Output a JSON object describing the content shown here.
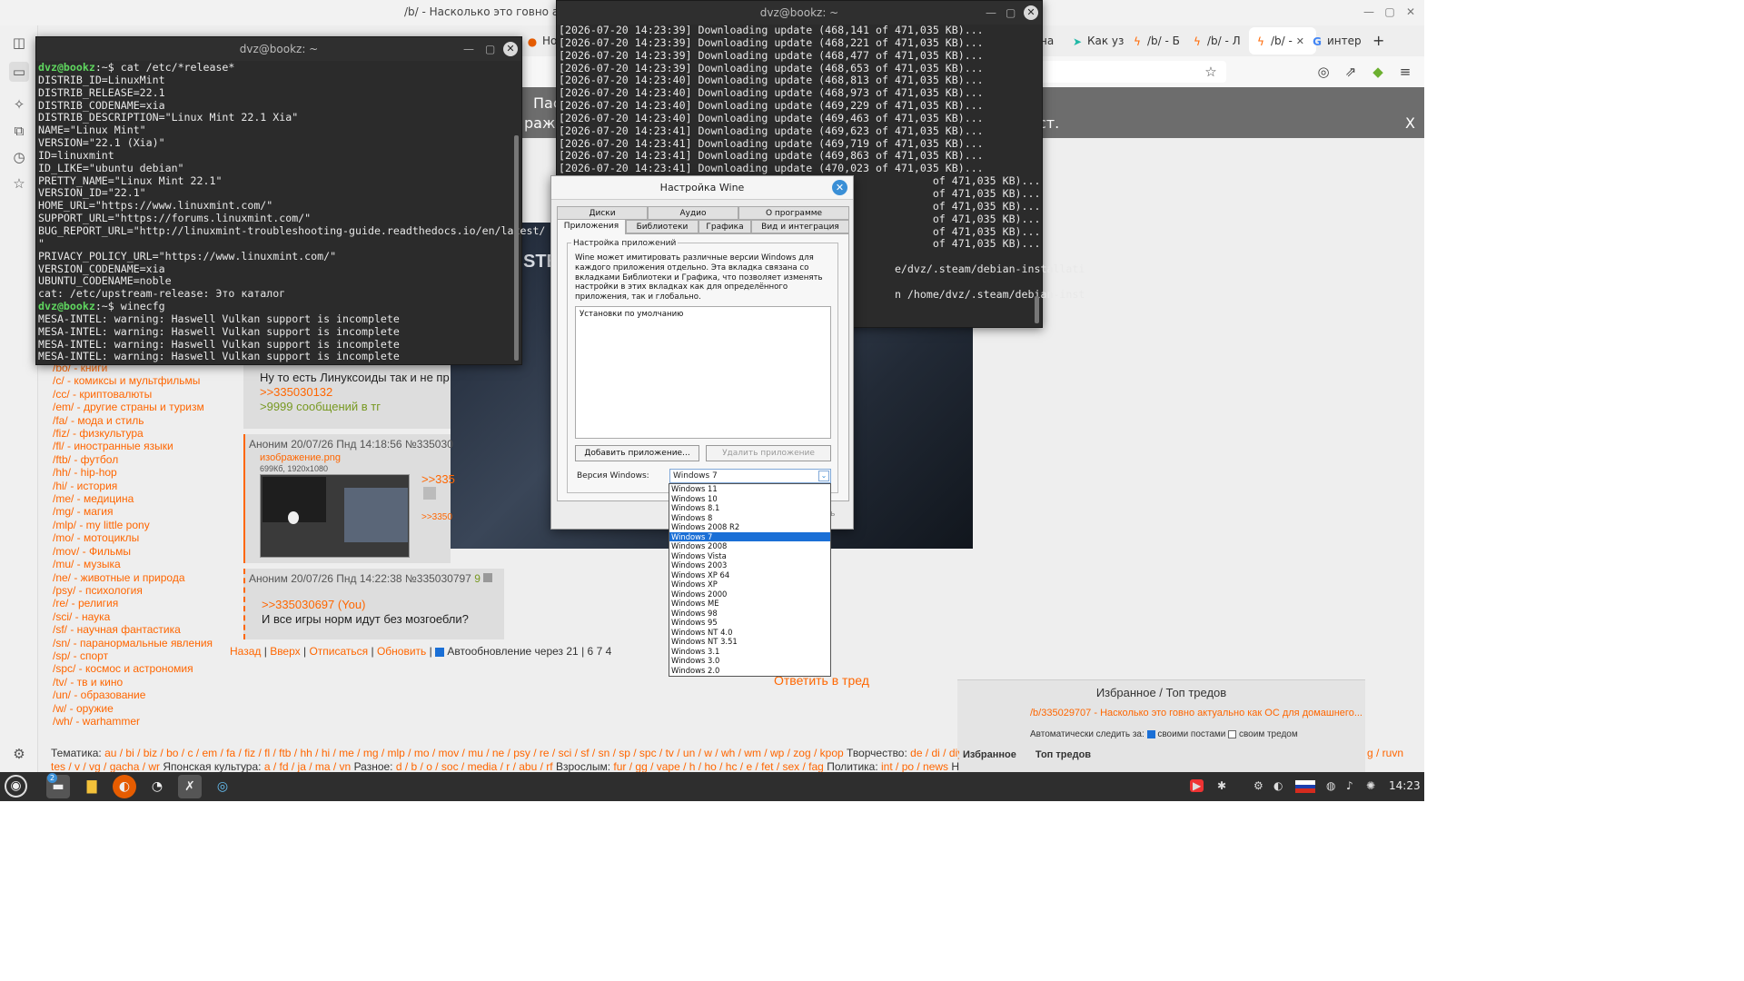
{
  "browser": {
    "window_title": "/b/ - Насколько это говно актуал",
    "tabs": [
      {
        "icon": "●",
        "label": "Нов"
      },
      {
        "icon": "",
        "label": "на"
      },
      {
        "icon": "➤",
        "label": "Как уз"
      },
      {
        "icon": "ϟ",
        "label": "/b/ - Б"
      },
      {
        "icon": "ϟ",
        "label": "/b/ - Л"
      },
      {
        "icon": "ϟ",
        "label": "/b/ -"
      },
      {
        "icon": "G",
        "label": "интер"
      }
    ],
    "tab_close": "✕",
    "new_tab": "+",
    "win_min": "—",
    "win_max": "▢",
    "win_close": "✕",
    "toolbar_icons": {
      "star": "☆",
      "account": "◎",
      "extensions": "⇗",
      "addon": "◆",
      "menu": "≡"
    }
  },
  "sidebar_icons": [
    "▭",
    "◫",
    "✧",
    "⧉",
    "◷",
    "☆",
    "⚙"
  ],
  "banner": {
    "line1": "Пас",
    "line2": "ражен",
    "line3": "ст.",
    "close": "X"
  },
  "dark_image_text": "STE",
  "boards": [
    "/bo/ - книги",
    "/c/ - комиксы и мультфильмы",
    "/cc/ - криптовалюты",
    "/em/ - другие страны и туризм",
    "/fa/ - мода и стиль",
    "/fiz/ - физкультура",
    "/fl/ - иностранные языки",
    "/ftb/ - футбол",
    "/hh/ - hip-hop",
    "/hi/ - история",
    "/me/ - медицина",
    "/mg/ - магия",
    "/mlp/ - my little pony",
    "/mo/ - мотоциклы",
    "/mov/ - Фильмы",
    "/mu/ - музыка",
    "/ne/ - животные и природа",
    "/psy/ - психология",
    "/re/ - религия",
    "/sci/ - наука",
    "/sf/ - научная фантастика",
    "/sn/ - паранормальные явления",
    "/sp/ - спорт",
    "/spc/ - космос и астрономия",
    "/tv/ - тв и кино",
    "/un/ - образование",
    "/w/ - оружие",
    "/wh/ - warhammer"
  ],
  "post1": {
    "text": "Ну то есть Линуксоиды так и не пр",
    "reply_link": ">>335030132",
    "greentext": ">9999 сообщений в тг"
  },
  "post2": {
    "meta": "Аноним   20/07/26 Пнд 14:18:56 №335030",
    "filename": "изображение.png",
    "fileinfo": "699Кб, 1920x1080",
    "reply1": ">>335",
    "reply2": ">>3350"
  },
  "post3": {
    "meta": "Аноним   20/07/26 Пнд 14:22:38 №335030797",
    "num": "9",
    "reply_link": ">>335030697 (You)",
    "text": "И все игры норм идут без мозгоебли?"
  },
  "thread_nav": {
    "back": "Назад",
    "up": "Вверх",
    "unsubscribe": "Отписаться",
    "refresh": "Обновить",
    "autoupdate": "Автообновление через 21",
    "posts": "6",
    "images": "7",
    "users": "4"
  },
  "reply_link": "Ответить в тред",
  "favorites": {
    "header": "Избранное / Топ тредов",
    "item": "/b/335029707 - Насколько это говно актуально как ОС для домашнего...",
    "watch_label": "Автоматически следить за:",
    "opt1": "своими постами",
    "opt2": "своим тредом",
    "tab1": "Избранное",
    "tab2": "Топ тредов"
  },
  "footer": {
    "line1_label": "Тематика:",
    "line1": "au / bi / biz / bo / c / em / fa / fiz / fl / ftb / hh / hi / me / mg / mlp / mo / mov / mu / ne / psy / re / sci / sf / sn / sp / spc / tv / un / w / wh / wm / wp / zog / kpop",
    "line1_b_label": "Творчество:",
    "line1_b": "de / di / diy",
    "line2_a": "tes / v / vg / gacha / wr",
    "line2_b_label": "Японская культура:",
    "line2_b": "a / fd / ja / ma / vn",
    "line2_c_label": "Разное:",
    "line2_c": "d / b / o / soc / media / r / abu / rf",
    "line2_d_label": "Взрослым:",
    "line2_d": "fur / gg / vape / h / ho / hc / e / fet / sex / fag",
    "line2_e_label": "Политика:",
    "line2_e": "int / po / news",
    "line2_f": "Нов",
    "right": "g / ruvn"
  },
  "terminal1": {
    "title": "dvz@bookz: ~",
    "lines": [
      {
        "prompt": "dvz@bookz",
        "rest": ":~$ cat /etc/*release*"
      },
      {
        "text": "DISTRIB_ID=LinuxMint"
      },
      {
        "text": "DISTRIB_RELEASE=22.1"
      },
      {
        "text": "DISTRIB_CODENAME=xia"
      },
      {
        "text": "DISTRIB_DESCRIPTION=\"Linux Mint 22.1 Xia\""
      },
      {
        "text": "NAME=\"Linux Mint\""
      },
      {
        "text": "VERSION=\"22.1 (Xia)\""
      },
      {
        "text": "ID=linuxmint"
      },
      {
        "text": "ID_LIKE=\"ubuntu debian\""
      },
      {
        "text": "PRETTY_NAME=\"Linux Mint 22.1\""
      },
      {
        "text": "VERSION_ID=\"22.1\""
      },
      {
        "text": "HOME_URL=\"https://www.linuxmint.com/\""
      },
      {
        "text": "SUPPORT_URL=\"https://forums.linuxmint.com/\""
      },
      {
        "text": "BUG_REPORT_URL=\"http://linuxmint-troubleshooting-guide.readthedocs.io/en/latest/"
      },
      {
        "text": "\""
      },
      {
        "text": "PRIVACY_POLICY_URL=\"https://www.linuxmint.com/\""
      },
      {
        "text": "VERSION_CODENAME=xia"
      },
      {
        "text": "UBUNTU_CODENAME=noble"
      },
      {
        "text": "cat: /etc/upstream-release: Это каталог"
      },
      {
        "prompt": "dvz@bookz",
        "rest": ":~$ winecfg"
      },
      {
        "text": "MESA-INTEL: warning: Haswell Vulkan support is incomplete"
      },
      {
        "text": "MESA-INTEL: warning: Haswell Vulkan support is incomplete"
      },
      {
        "text": "MESA-INTEL: warning: Haswell Vulkan support is incomplete"
      },
      {
        "text": "MESA-INTEL: warning: Haswell Vulkan support is incomplete"
      }
    ]
  },
  "terminal2": {
    "title": "dvz@bookz: ~",
    "lines": [
      "[2026-07-20 14:23:39] Downloading update (468,141 of 471,035 KB)...",
      "[2026-07-20 14:23:39] Downloading update (468,221 of 471,035 KB)...",
      "[2026-07-20 14:23:39] Downloading update (468,477 of 471,035 KB)...",
      "[2026-07-20 14:23:39] Downloading update (468,653 of 471,035 KB)...",
      "[2026-07-20 14:23:40] Downloading update (468,813 of 471,035 KB)...",
      "[2026-07-20 14:23:40] Downloading update (468,973 of 471,035 KB)...",
      "[2026-07-20 14:23:40] Downloading update (469,229 of 471,035 KB)...",
      "[2026-07-20 14:23:40] Downloading update (469,463 of 471,035 KB)...",
      "[2026-07-20 14:23:41] Downloading update (469,623 of 471,035 KB)...",
      "[2026-07-20 14:23:41] Downloading update (469,719 of 471,035 KB)...",
      "[2026-07-20 14:23:41] Downloading update (469,863 of 471,035 KB)...",
      "[2026-07-20 14:23:41] Downloading update (470,023 of 471,035 KB)...",
      "                                                           of 471,035 KB)...",
      "                                                           of 471,035 KB)...",
      "                                                           of 471,035 KB)...",
      "                                                           of 471,035 KB)...",
      "                                                           of 471,035 KB)...",
      "                                                           of 471,035 KB)...",
      "",
      "                                                     e/dvz/.steam/debian-installati",
      "",
      "                                                     n /home/dvz/.steam/debian-inst"
    ]
  },
  "wine": {
    "title": "Настройка Wine",
    "close": "✕",
    "tabs_row1": [
      "Диски",
      "Аудио",
      "О программе"
    ],
    "tabs_row2": [
      "Приложения",
      "Библиотеки",
      "Графика",
      "Вид и интеграция"
    ],
    "group_label": "Настройка приложений",
    "description": "Wine может имитировать различные версии Windows для каждого приложения отдельно. Эта вкладка связана со вкладками Библиотеки и Графика, что позволяет изменять настройки в этих вкладках как для определённого приложения, так и глобально.",
    "default_item": "Установки по умолчанию",
    "add_button": "Добавить приложение...",
    "remove_button": "Удалить приложение",
    "version_label": "Версия Windows:",
    "version_value": "Windows 7",
    "ok_partial": "ить",
    "versions": [
      "Windows 11",
      "Windows 10",
      "Windows 8.1",
      "Windows 8",
      "Windows 2008 R2",
      "Windows 7",
      "Windows 2008",
      "Windows Vista",
      "Windows 2003",
      "Windows XP 64",
      "Windows XP",
      "Windows 2000",
      "Windows ME",
      "Windows 98",
      "Windows 95",
      "Windows NT 4.0",
      "Windows NT 3.51",
      "Windows 3.1",
      "Windows 3.0",
      "Windows 2.0"
    ],
    "selected_version": "Windows 7"
  },
  "taskbar": {
    "menu_icon": "◉",
    "badge": "2",
    "clock": "14:23",
    "tray_icons": [
      "▶",
      "✱",
      "⚙",
      "◐",
      "▤",
      "◍",
      "♪",
      "✺"
    ]
  }
}
